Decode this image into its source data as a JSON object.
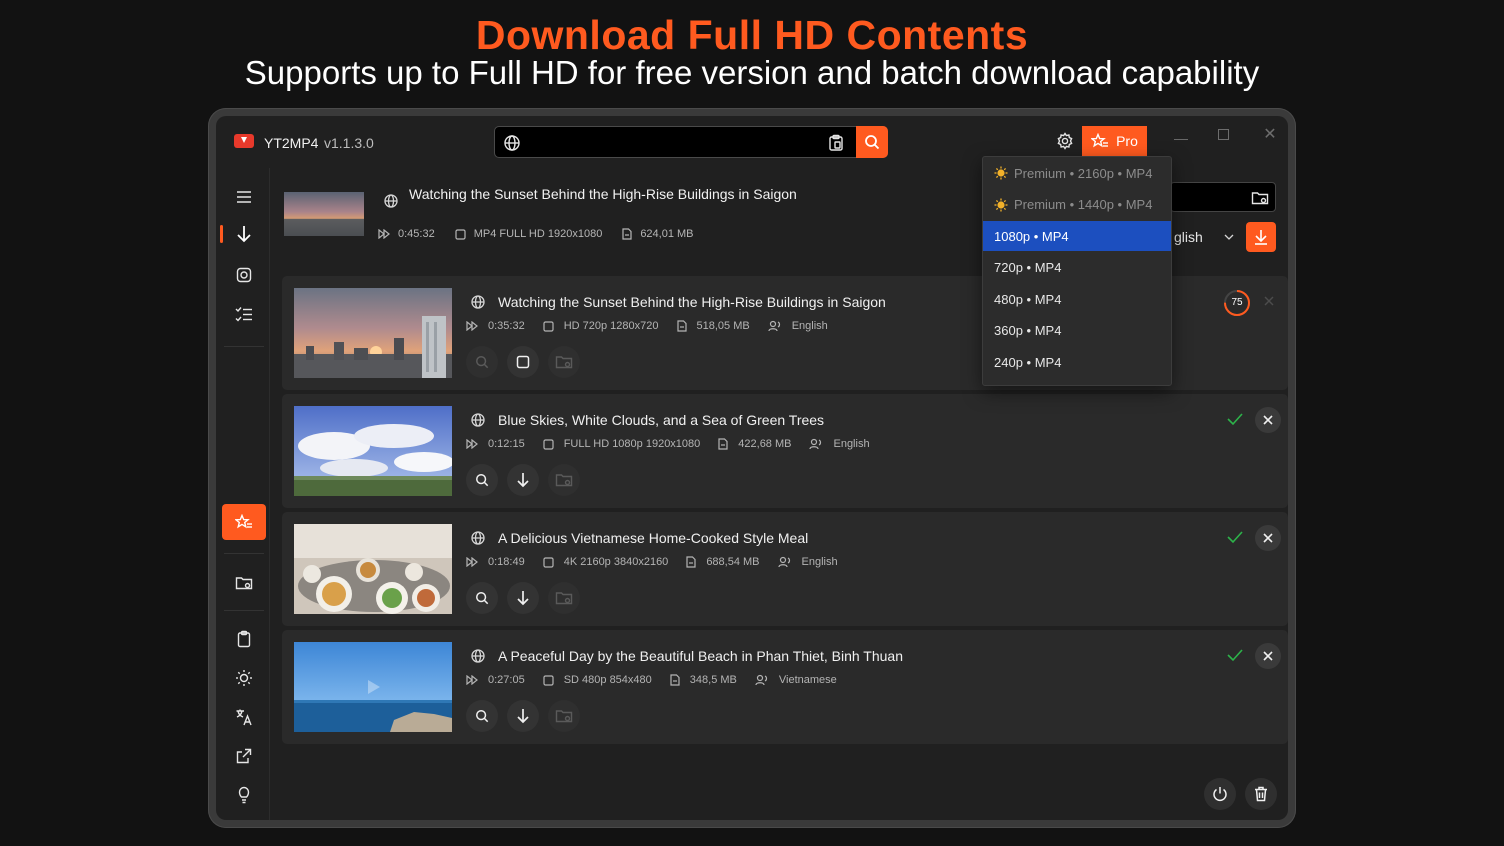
{
  "promo": {
    "headline": "Download Full HD Contents",
    "subline": "Supports up to Full HD for free version and batch download capability"
  },
  "app": {
    "name": "YT2MP4",
    "version": "v1.1.3.0",
    "pro_label": "Pro",
    "url_value": "",
    "url_placeholder": ""
  },
  "colors": {
    "accent": "#ff5a1f",
    "selected": "#1c4fbf",
    "success": "#2db34a"
  },
  "top_item": {
    "title": "Watching the Sunset Behind the High-Rise Buildings in Saigon",
    "duration": "0:45:32",
    "format": "MP4 FULL HD 1920x1080",
    "size": "624,01 MB",
    "language": "glish"
  },
  "quality_menu": [
    {
      "label": "Premium • 2160p • MP4",
      "premium": true
    },
    {
      "label": "Premium • 1440p • MP4",
      "premium": true
    },
    {
      "label": "1080p • MP4",
      "selected": true
    },
    {
      "label": "720p • MP4"
    },
    {
      "label": "480p • MP4"
    },
    {
      "label": "360p • MP4"
    },
    {
      "label": "240p • MP4"
    }
  ],
  "downloads": [
    {
      "title": "Watching the Sunset Behind the High-Rise Buildings in Saigon",
      "duration": "0:35:32",
      "format": "HD 720p 1280x720",
      "size": "518,05 MB",
      "language": "English",
      "status": "downloading",
      "progress": "75"
    },
    {
      "title": "Blue Skies, White Clouds, and a Sea of Green Trees",
      "duration": "0:12:15",
      "format": "FULL HD 1080p 1920x1080",
      "size": "422,68 MB",
      "language": "English",
      "status": "done"
    },
    {
      "title": "A Delicious Vietnamese Home-Cooked Style Meal",
      "duration": "0:18:49",
      "format": "4K 2160p 3840x2160",
      "size": "688,54 MB",
      "language": "English",
      "status": "done"
    },
    {
      "title": "A Peaceful Day by the Beautiful Beach in Phan Thiet, Binh Thuan",
      "duration": "0:27:05",
      "format": "SD 480p 854x480",
      "size": "348,5 MB",
      "language": "Vietnamese",
      "status": "done"
    }
  ],
  "icons": {
    "sidebar": [
      "menu-icon",
      "download-icon",
      "record-icon",
      "checklist-icon",
      "pro-star-icon",
      "folder-settings-icon",
      "clipboard-icon",
      "theme-icon",
      "language-icon",
      "share-icon",
      "tip-icon"
    ],
    "bottom": [
      "power-icon",
      "trash-icon"
    ]
  }
}
